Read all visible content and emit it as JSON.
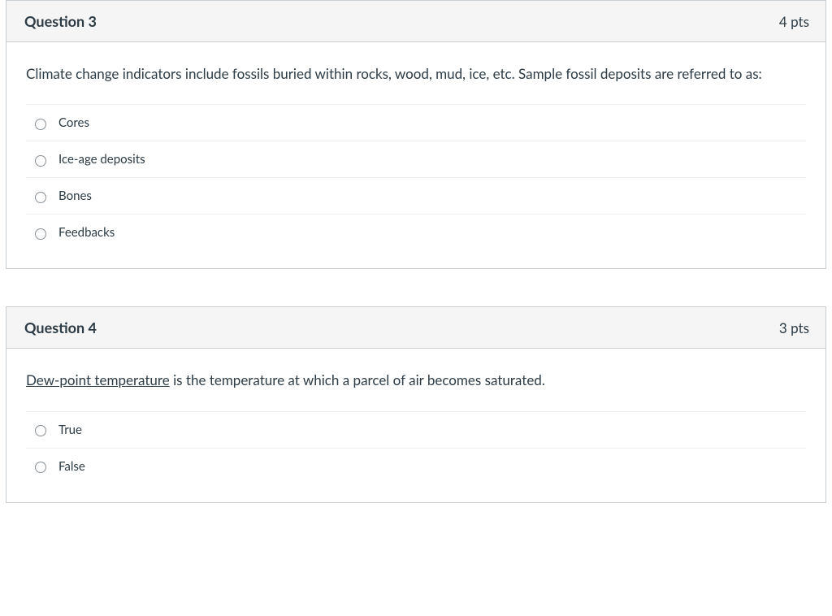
{
  "questions": [
    {
      "title": "Question 3",
      "points": "4 pts",
      "prompt_plain": "Climate change indicators include fossils buried within rocks, wood, mud, ice, etc. Sample fossil deposits are referred to as:",
      "options": [
        {
          "label": "Cores"
        },
        {
          "label": "Ice-age deposits"
        },
        {
          "label": "Bones"
        },
        {
          "label": "Feedbacks"
        }
      ]
    },
    {
      "title": "Question 4",
      "points": "3 pts",
      "prompt_underline_part": "Dew-point temperature",
      "prompt_rest": " is the temperature at which a parcel of air becomes saturated.",
      "options": [
        {
          "label": "True"
        },
        {
          "label": "False"
        }
      ]
    }
  ]
}
